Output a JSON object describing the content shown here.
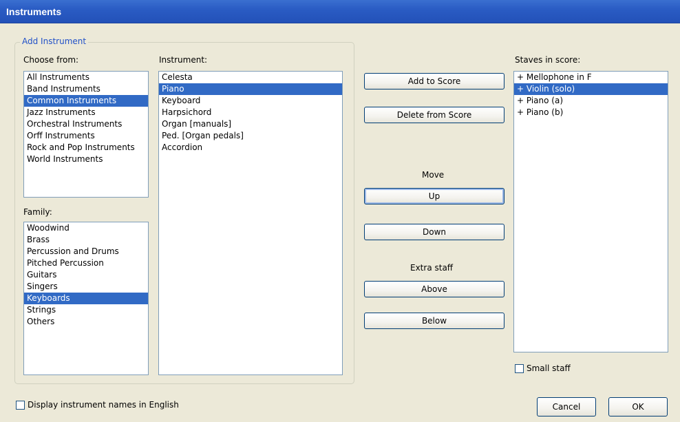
{
  "window": {
    "title": "Instruments"
  },
  "add_instrument_group": {
    "label": "Add Instrument"
  },
  "choose_from": {
    "label": "Choose from:",
    "items": [
      "All Instruments",
      "Band Instruments",
      "Common Instruments",
      "Jazz Instruments",
      "Orchestral Instruments",
      "Orff Instruments",
      "Rock and Pop Instruments",
      "World Instruments"
    ],
    "selected": "Common Instruments"
  },
  "family": {
    "label": "Family:",
    "items": [
      "Woodwind",
      "Brass",
      "Percussion and Drums",
      "Pitched Percussion",
      "Guitars",
      "Singers",
      "Keyboards",
      "Strings",
      "Others"
    ],
    "selected": "Keyboards"
  },
  "instrument": {
    "label": "Instrument:",
    "items": [
      "Celesta",
      "Piano",
      "Keyboard",
      "Harpsichord",
      "Organ [manuals]",
      "Ped. [Organ pedals]",
      "Accordion"
    ],
    "selected": "Piano"
  },
  "actions": {
    "add_to_score": "Add to Score",
    "delete_from_score": "Delete from Score",
    "move_label": "Move",
    "up": "Up",
    "down": "Down",
    "extra_staff_label": "Extra staff",
    "above": "Above",
    "below": "Below"
  },
  "staves": {
    "label": "Staves in score:",
    "items": [
      "+ Mellophone in F",
      "+ Violin (solo)",
      "+ Piano (a)",
      "+ Piano (b)"
    ],
    "selected": "+ Violin (solo)"
  },
  "small_staff": {
    "label": "Small staff",
    "checked": false
  },
  "display_english": {
    "label": "Display instrument names in English",
    "checked": false
  },
  "footer": {
    "cancel": "Cancel",
    "ok": "OK"
  },
  "colors": {
    "titlebar": "#2a5cc4",
    "selection": "#316ac5",
    "dialog_bg": "#ece9d8",
    "group_label": "#2050c8"
  }
}
